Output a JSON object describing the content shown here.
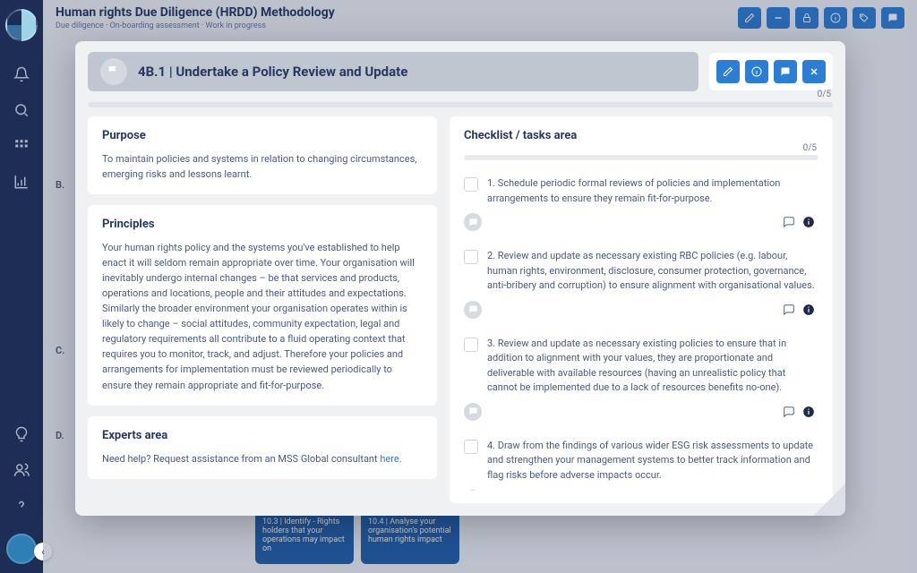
{
  "bg": {
    "title": "Human rights Due Diligence (HRDD) Methodology",
    "subtitle": "Due diligence · On-boarding assessment · Work in progress",
    "cards": [
      {
        "title": "10.3 | Identify - Rights holders that your operations may impact on"
      },
      {
        "title": "10.4 | Analyse your organisation's potential human rights impact"
      }
    ],
    "labels": [
      "B.",
      "C.",
      "D."
    ]
  },
  "modal": {
    "title": "4B.1 | Undertake a Policy Review and Update",
    "progress_count": "0/5"
  },
  "purpose": {
    "heading": "Purpose",
    "text": "To maintain policies and systems in relation to changing circumstances, emerging risks and lessons learnt."
  },
  "principles": {
    "heading": "Principles",
    "text": "Your human rights policy and the systems you've established to help enact it will seldom remain appropriate over time. Your organisation will inevitably undergo internal changes – be that services and products, operations and locations, people and their attitudes and expectations.  Similarly the broader environment your organisation operates within is likely to change – social attitudes, community expectation, legal and regulatory requirements all contribute to a fluid operating context that requires you to monitor, track, and adjust.  Therefore your policies and arrangements for implementation must be reviewed periodically to ensure they remain appropriate and fit-for-purpose."
  },
  "experts": {
    "heading": "Experts area",
    "text": "Need help? Request assistance from an MSS Global consultant ",
    "link": "here"
  },
  "checklist": {
    "heading": "Checklist / tasks area",
    "progress_count": "0/5",
    "tasks": [
      "1. Schedule periodic formal reviews of policies and implementation arrangements to ensure they remain fit-for-purpose.",
      "2. Review and update as necessary existing RBC policies (e.g. labour, human rights, environment, disclosure, consumer protection, governance, anti-bribery and corruption) to ensure alignment with organisational values.",
      "3. Review and update as necessary existing policies to ensure that in addition to alignment with your values, they are proportionate and deliverable with available resources (having an unrealistic policy that cannot be implemented due to a lack of resources benefits no-one).",
      "4. Draw from the findings of various wider ESG risk assessments to update and strengthen your management systems to better track information and flag risks before adverse impacts occur."
    ]
  }
}
